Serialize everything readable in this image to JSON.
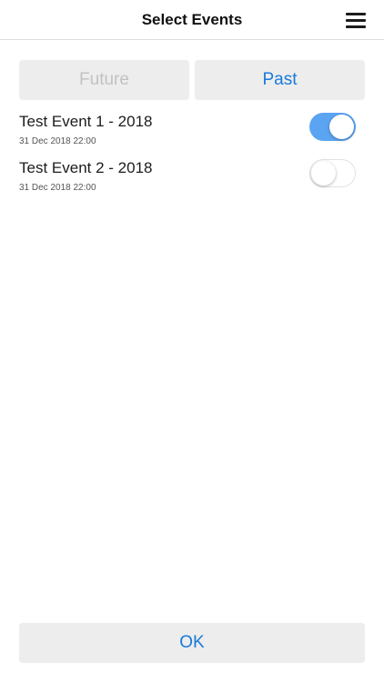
{
  "header": {
    "title": "Select Events",
    "menu_icon": "hamburger-menu-icon"
  },
  "segment": {
    "future_label": "Future",
    "past_label": "Past",
    "selected": "Past"
  },
  "events": [
    {
      "title": "Test Event 1 - 2018",
      "date": "31 Dec 2018 22:00",
      "selected": true
    },
    {
      "title": "Test Event 2 - 2018",
      "date": "31 Dec 2018 22:00",
      "selected": false
    }
  ],
  "footer": {
    "ok_label": "OK"
  },
  "colors": {
    "accent": "#1a7ad9",
    "toggle_on": "#5ba4f2",
    "button_bg": "#ededed",
    "disabled_text": "#c2c2c2"
  }
}
